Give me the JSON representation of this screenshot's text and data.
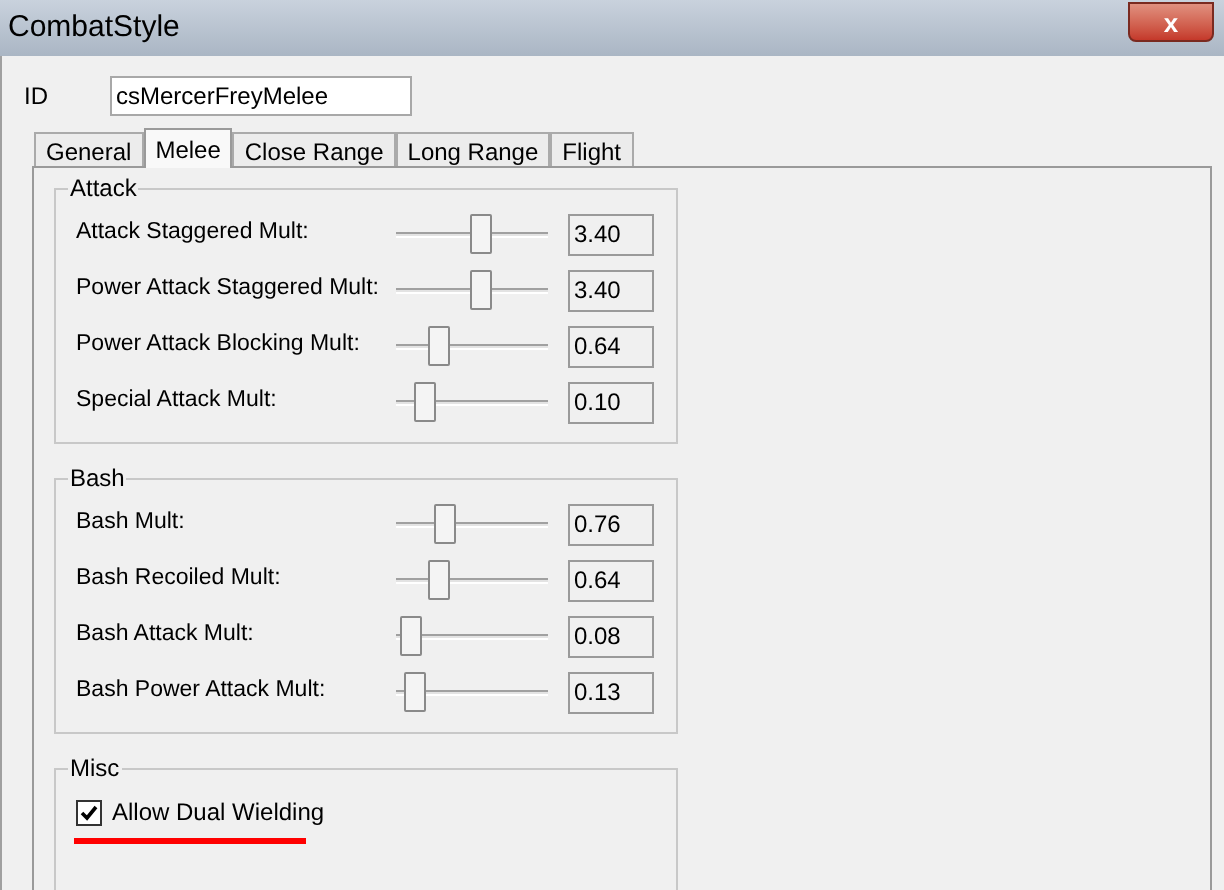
{
  "window": {
    "title": "CombatStyle",
    "close": "x"
  },
  "id_field": {
    "label": "ID",
    "value": "csMercerFreyMelee"
  },
  "tabs": [
    {
      "label": "General",
      "selected": false
    },
    {
      "label": "Melee",
      "selected": true
    },
    {
      "label": "Close Range",
      "selected": false
    },
    {
      "label": "Long Range",
      "selected": false
    },
    {
      "label": "Flight",
      "selected": false
    }
  ],
  "groups": [
    {
      "title": "Attack",
      "rows": [
        {
          "label": "Attack Staggered Mult:",
          "level": 0.55,
          "value": "3.40"
        },
        {
          "label": "Power Attack Staggered Mult:",
          "level": 0.55,
          "value": "3.40"
        },
        {
          "label": "Power Attack Blocking Mult:",
          "level": 0.28,
          "value": "0.64"
        },
        {
          "label": "Special Attack Mult:",
          "level": 0.18,
          "value": "0.10"
        }
      ]
    },
    {
      "title": "Bash",
      "rows": [
        {
          "label": "Bash Mult:",
          "level": 0.31,
          "value": "0.76"
        },
        {
          "label": "Bash Recoiled Mult:",
          "level": 0.27,
          "value": "0.64"
        },
        {
          "label": "Bash Attack Mult:",
          "level": 0.09,
          "value": "0.08"
        },
        {
          "label": "Bash Power Attack Mult:",
          "level": 0.12,
          "value": "0.13"
        }
      ]
    }
  ],
  "misc": {
    "title": "Misc",
    "checkbox": {
      "label": "Allow Dual Wielding",
      "checked": true,
      "underlined": true
    }
  }
}
